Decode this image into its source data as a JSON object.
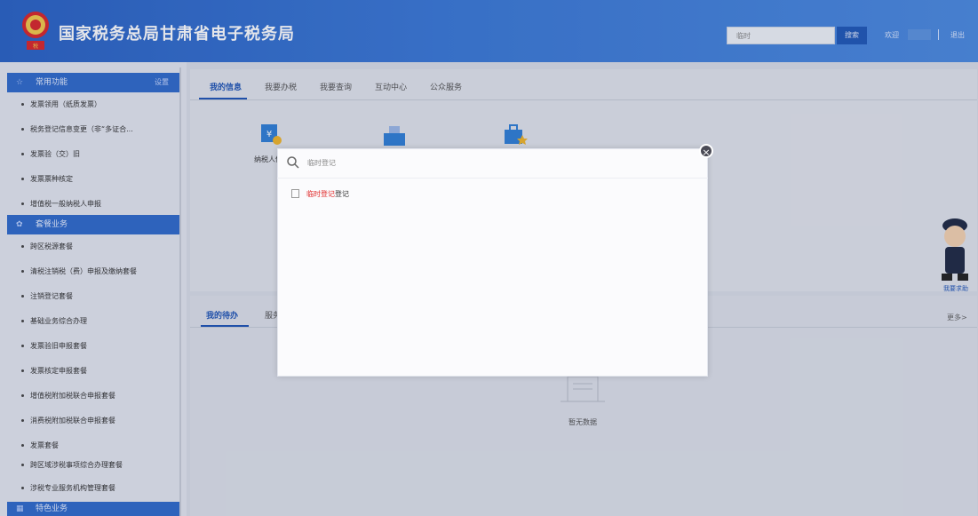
{
  "header": {
    "title": "国家税务总局甘肃省电子税务局",
    "search_value": "临时",
    "search_button": "搜索",
    "welcome": "欢迎",
    "logout": "退出",
    "brand_color": "#2a62c4"
  },
  "sidebar": {
    "common_header": "常用功能",
    "common_settings": "设置",
    "common_items": [
      "发票领用（纸质发票）",
      "税务登记信息变更（非“多证合...",
      "发票验（交）旧",
      "发票票种核定",
      "增值税一般纳税人申报"
    ],
    "package_header": "套餐业务",
    "package_items": [
      "跨区税源套餐",
      "清税注销税（费）申报及缴纳套餐",
      "注销登记套餐",
      "基础业务综合办理",
      "发票验旧申报套餐",
      "发票核定申报套餐",
      "增值税附加税联合申报套餐",
      "消费税附加税联合申报套餐",
      "发票套餐",
      "跨区域涉税事项综合办理套餐",
      "涉税专业服务机构管理套餐"
    ],
    "special_header": "特色业务"
  },
  "tabs": [
    "我的信息",
    "我要办税",
    "我要查询",
    "互动中心",
    "公众服务"
  ],
  "apps": {
    "app1_label": "纳税人信息"
  },
  "lower": {
    "tab_active": "我的待办",
    "tab_second": "服务",
    "more": "更多>",
    "empty": "暂无数据"
  },
  "helper": {
    "label": "我要求助"
  },
  "modal": {
    "search_value": "临时登记",
    "result_highlight": "临时登记",
    "result_suffix": "登记"
  }
}
